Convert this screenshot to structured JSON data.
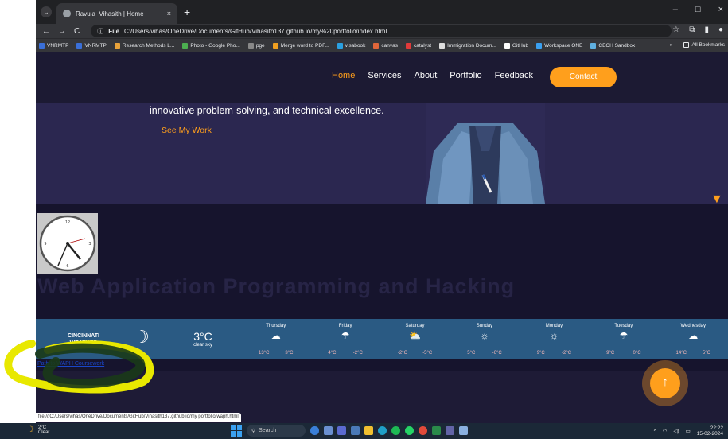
{
  "browser": {
    "tab_title": "Ravula_Vihasith | Home",
    "tab_close": "×",
    "new_tab": "+",
    "window_controls": [
      "–",
      "□",
      "×"
    ],
    "nav_buttons": [
      "←",
      "→",
      "C"
    ],
    "address_chip": "File",
    "address_url": "C:/Users/vihas/OneDrive/Documents/GitHub/Vihasith137.github.io/my%20portfolio/index.html",
    "bookmarks": [
      "VNRMTP",
      "VNRMTP",
      "Research Methods L...",
      "Photo - Google Pho...",
      "pge",
      "Merge word to PDF...",
      "visabook",
      "canvas",
      "catalyst",
      "Immigration Docum...",
      "GitHub",
      "Workspace ONE",
      "CECH Sandbox"
    ],
    "bookmark_colors": [
      "#3a6fd8",
      "#3a6fd8",
      "#e8a23a",
      "#4caf50",
      "#888888",
      "#f0a020",
      "#2aa0e0",
      "#e0663a",
      "#e03a3a",
      "#dddddd",
      "#ffffff",
      "#3aa0f0",
      "#5fb0e0"
    ],
    "all_bookmarks": "All Bookmarks",
    "more_bookmarks": "»"
  },
  "site": {
    "nav": [
      "Home",
      "Services",
      "About",
      "Portfolio",
      "Feedback"
    ],
    "contact": "Contact",
    "hero_text": "innovative problem-solving, and technical excellence.",
    "see_work": "See My Work",
    "waph_title": "Web Application Programming and Hacking",
    "waph_link": "Path to WAPH Coursework",
    "scroll_top": "↑",
    "accent": "#ff9f1c"
  },
  "weather": {
    "city": "CINCINNATI",
    "label": "WEATHER",
    "current_temp": "3°C",
    "current_desc": "clear sky",
    "days": [
      {
        "name": "Thursday",
        "icon": "☁",
        "hi": "13°C",
        "lo": "3°C"
      },
      {
        "name": "Friday",
        "icon": "☂",
        "hi": "4°C",
        "lo": "-2°C"
      },
      {
        "name": "Saturday",
        "icon": "⛅",
        "hi": "-2°C",
        "lo": "-5°C"
      },
      {
        "name": "Sunday",
        "icon": "☼",
        "hi": "5°C",
        "lo": "-6°C"
      },
      {
        "name": "Monday",
        "icon": "☼",
        "hi": "9°C",
        "lo": "-2°C"
      },
      {
        "name": "Tuesday",
        "icon": "☂",
        "hi": "9°C",
        "lo": "0°C"
      },
      {
        "name": "Wednesday",
        "icon": "☁",
        "hi": "14°C",
        "lo": "5°C"
      }
    ]
  },
  "status_url": "file:///C:/Users/vihas/OneDrive/Documents/GitHub/Vihasith137.github.io/my portfolio/waph.html",
  "taskbar": {
    "weather_temp": "2°C",
    "weather_desc": "Clear",
    "search": "Search",
    "time": "22:22",
    "date": "15-02-2024"
  }
}
